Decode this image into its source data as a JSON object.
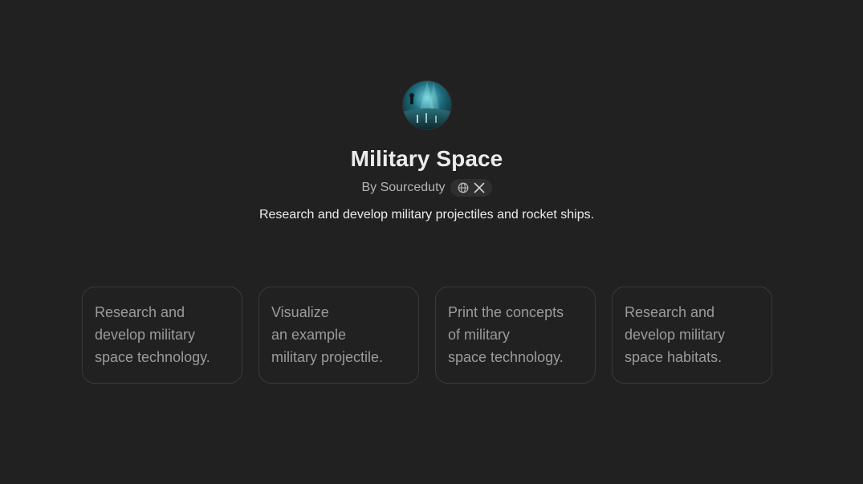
{
  "gpt": {
    "name": "Military Space",
    "author": "By Sourceduty",
    "description": "Research and develop military projectiles and rocket ships.",
    "avatar_icon": "space-soldier-avatar",
    "social_icons": [
      "globe-icon",
      "x-logo-icon"
    ]
  },
  "conversation_starters": [
    {
      "label": "Research and\ndevelop military\nspace technology."
    },
    {
      "label": "Visualize\nan example\nmilitary projectile."
    },
    {
      "label": "Print the concepts\nof military\nspace technology."
    },
    {
      "label": "Research and\ndevelop military\nspace habitats."
    }
  ],
  "colors": {
    "background": "#212121",
    "title": "#ececec",
    "byline": "#b4b4b4",
    "starter_text": "#9b9b9b",
    "starter_border": "#3a3a3a"
  }
}
